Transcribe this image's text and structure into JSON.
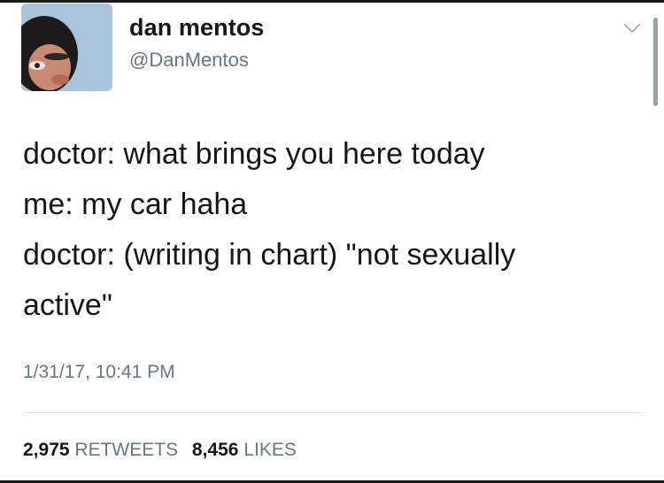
{
  "author": {
    "display_name": "dan mentos",
    "handle": "@DanMentos"
  },
  "tweet": {
    "lines": [
      "doctor: what brings you here today",
      "me: my car haha",
      "doctor: (writing in chart) \"not sexually",
      "active\""
    ],
    "timestamp": "1/31/17, 10:41 PM"
  },
  "stats": {
    "retweets_count": "2,975",
    "retweets_label": "RETWEETS",
    "likes_count": "8,456",
    "likes_label": "LIKES"
  },
  "icons": {
    "caret": "chevron-down-icon"
  },
  "colors": {
    "text": "#14171a",
    "secondary_text": "#657786",
    "avatar_background": "#a9c4db"
  }
}
